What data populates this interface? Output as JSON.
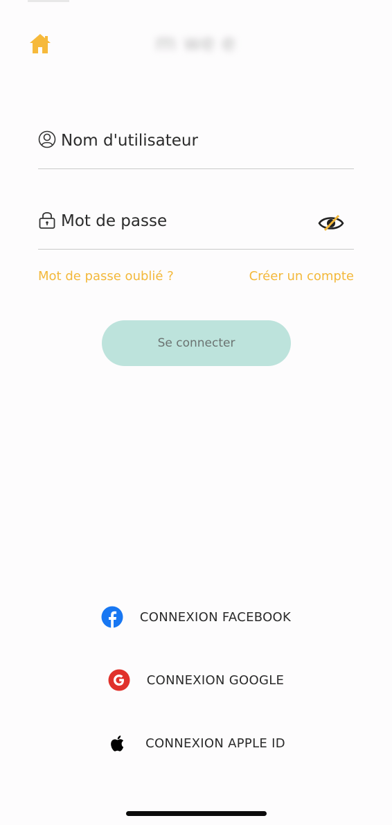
{
  "header": {
    "home_icon": "home-icon",
    "logo_text": "m  we  e"
  },
  "login_form": {
    "username": {
      "icon": "user-circle-icon",
      "placeholder": "Nom d'utilisateur",
      "value": ""
    },
    "password": {
      "icon": "lock-icon",
      "placeholder": "Mot de passe",
      "value": "",
      "toggle_icon": "eye-slash-icon"
    },
    "forgot_password_label": "Mot de passe oublié ?",
    "create_account_label": "Créer un compte",
    "connect_label": "Se connecter"
  },
  "social_login": {
    "facebook": {
      "icon": "facebook-icon",
      "label": "CONNEXION FACEBOOK"
    },
    "google": {
      "icon": "google-icon",
      "label": "CONNEXION GOOGLE"
    },
    "apple": {
      "icon": "apple-icon",
      "label": "CONNEXION APPLE ID"
    }
  },
  "colors": {
    "accent": "#f3b83a",
    "button_bg": "#bde3dc",
    "facebook_blue": "#1877f2",
    "google_red": "#e0312b"
  }
}
